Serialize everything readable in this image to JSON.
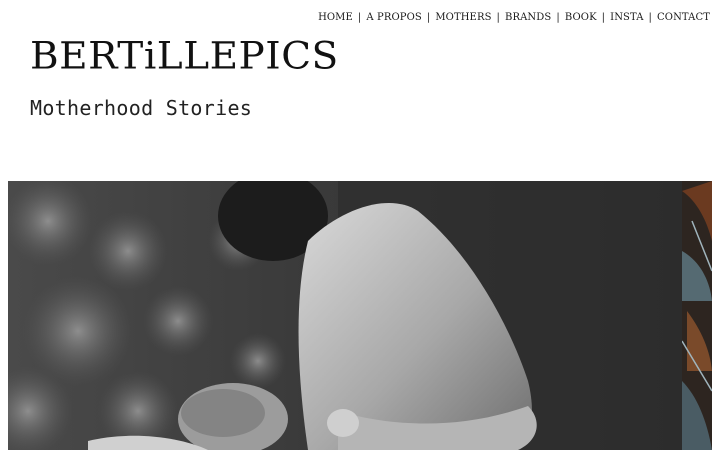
{
  "nav": {
    "items": [
      {
        "label": "HOME"
      },
      {
        "label": "A PROPOS"
      },
      {
        "label": "MOTHERS"
      },
      {
        "label": "BRANDS"
      },
      {
        "label": "BOOK"
      },
      {
        "label": "INSTA"
      },
      {
        "label": "CONTACT"
      }
    ],
    "separator": "|"
  },
  "brand": {
    "logo_text": "BERTiLLEPICS",
    "tagline": "Motherhood Stories"
  },
  "hero": {
    "main_photo": "black-and-white breastfeeding photo",
    "side_photo": "tropical leaf photo"
  },
  "colors": {
    "text": "#1a1a1a",
    "background": "#ffffff",
    "photo_dark": "#2b2b2b"
  }
}
